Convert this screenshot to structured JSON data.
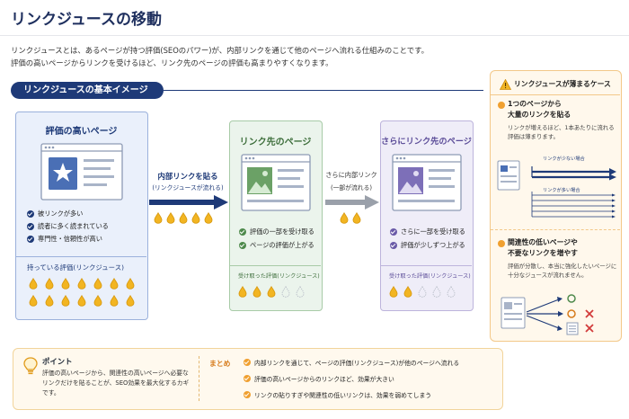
{
  "title": "リンクジュースの移動",
  "intro": [
    "リンクジュースとは、あるページが持つ評価(SEOのパワー)が、内部リンクを通じて他のページへ流れる仕組みのことです。",
    "評価の高いページからリンクを受けるほど、リンク先のページの評価も高まりやすくなります。"
  ],
  "section_label": "リンクジュースの基本イメージ",
  "colors": {
    "navy": "#1e3a78",
    "green": "#4e8a4c",
    "purple": "#6a5aa8",
    "orange": "#f0a030",
    "drop": "#f2b522"
  },
  "source_card": {
    "title": "評価の高いページ",
    "points": [
      "被リンクが多い",
      "読者に多く読まれている",
      "専門性・信頼性が高い"
    ],
    "juice_label": "持っている評価(リンクジュース)",
    "drops": 14
  },
  "arrow1": {
    "line1": "内部リンクを貼る",
    "line2": "(リンクジュースが流れる)",
    "drops": 5
  },
  "target_card": {
    "title": "リンク先のページ",
    "points": [
      "評価の一部を受け取る",
      "ページの評価が上がる"
    ],
    "juice_label": "受け取った評価(リンクジュース)",
    "filled": 3,
    "empty": 2
  },
  "arrow2": {
    "line1": "さらに内部リンク",
    "line2": "(一部が流れる)",
    "drops": 2
  },
  "final_card": {
    "title": "さらにリンク先のページ",
    "points": [
      "さらに一部を受け取る",
      "評価が少しずつ上がる"
    ],
    "juice_label": "受け取った評価(リンクジュース)",
    "filled": 2,
    "empty": 3
  },
  "sidebar": {
    "title": "リンクジュースが薄まるケース",
    "case1_title": [
      "1つのページから",
      "大量のリンクを貼る"
    ],
    "case1_text": "リンクが増えるほど、1本あたりに流れる評価は薄まります。",
    "few_label": "リンクが少ない場合",
    "many_label": "リンクが多い場合",
    "case2_title": [
      "関連性の低いページや",
      "不要なリンクを増やす"
    ],
    "case2_text": "評価が分散し、本当に強化したいページに十分なジュースが流れません。"
  },
  "point": {
    "label": "ポイント",
    "text": "評価の高いページから、関連性の高いページへ必要なリンクだけを貼ることが、SEO効果を最大化するカギです。"
  },
  "summary": {
    "label": "まとめ",
    "items": [
      "内部リンクを通じて、ページの評価(リンクジュース)が他のページへ流れる",
      "評価の高いページからのリンクほど、効果が大きい",
      "リンクの貼りすぎや関連性の低いリンクは、効果を弱めてしまう"
    ]
  }
}
